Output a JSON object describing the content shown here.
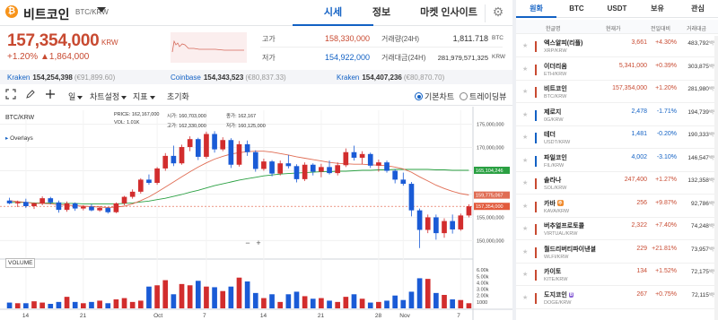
{
  "header": {
    "coin_glyph": "₿",
    "coin_name": "비트코인",
    "pair": "BTC/KRW",
    "tabs": [
      "시세",
      "정보",
      "마켓 인사이트"
    ],
    "active_tab": "시세"
  },
  "ticker": {
    "price": "157,354,000",
    "unit": "KRW",
    "change_pct": "+1.20%",
    "change_abs": "▲1,864,000",
    "stats": [
      {
        "label": "고가",
        "value": "158,330,000",
        "tone": "red"
      },
      {
        "label": "거래량(24H)",
        "value": "1,811.718",
        "unit": "BTC",
        "tone": "dark"
      },
      {
        "label": "저가",
        "value": "154,922,000",
        "tone": "blue"
      },
      {
        "label": "거래대금(24H)",
        "value": "281,979,571,325",
        "unit": "KRW",
        "tone": "dark"
      }
    ]
  },
  "exchanges": [
    {
      "name": "Kraken",
      "price": "154,254,398",
      "krw": "(€91,899.60)"
    },
    {
      "name": "Coinbase",
      "price": "154,343,523",
      "krw": "(€80,837.33)"
    },
    {
      "name": "Kraken",
      "price": "154,407,236",
      "krw": "(€80,870.70)"
    }
  ],
  "toolbar": {
    "interval": "일",
    "settings": "차트설정",
    "indicators": "지표",
    "reset": "초기화",
    "basic_chart": "기본차트",
    "tradingview": "트레이딩뷰"
  },
  "chart": {
    "symbol_label": "BTC/KRW",
    "overlays_label": "Overlays",
    "ohlc_left": [
      "PRICE:",
      "VOL:"
    ],
    "ohlc_left_vals": [
      "162,167,000",
      "1.01K"
    ],
    "ohlc_mid_labels": [
      "시가:",
      "고가:"
    ],
    "ohlc_mid_vals": [
      "160,703,000",
      "162,330,000"
    ],
    "ohlc_right_labels": [
      "종가:",
      "저가:"
    ],
    "ohlc_right_vals": [
      "162,167",
      "160,125,000"
    ],
    "volume_label": "VOLUME",
    "y_ticks": [
      "175,000,000",
      "170,000,000",
      "165,000,000",
      "160,000,000",
      "155,000,000",
      "150,000,000"
    ],
    "y_tags": [
      {
        "value": "165,104,246",
        "color": "#2aa042"
      },
      {
        "value": "159,775,067",
        "color": "#e06d54"
      },
      {
        "value": "157,354,000",
        "color": "#e25a3c"
      }
    ],
    "vol_ticks": [
      "6.00k",
      "5.00k",
      "4.00k",
      "3.00k",
      "2.00k",
      "1000"
    ],
    "x_ticks": [
      "14",
      "21",
      "Oct",
      "7",
      "14",
      "21",
      "28",
      "Nov",
      "7"
    ],
    "up_color": "#d22d2d",
    "down_color": "#1a5bd6"
  },
  "chart_data": {
    "type": "candlestick",
    "title": "BTC/KRW",
    "ylim": [
      147000000,
      178000000
    ],
    "series_ma": [
      {
        "name": "MA-long",
        "color": "#2aa042"
      },
      {
        "name": "MA-short",
        "color": "#e06d54"
      }
    ],
    "candles": [
      [
        158.6,
        159.2,
        157.8,
        158.0
      ],
      [
        158.0,
        158.6,
        157.2,
        158.3
      ],
      [
        158.3,
        159.0,
        157.0,
        157.4
      ],
      [
        157.4,
        158.2,
        156.8,
        158.0
      ],
      [
        158.0,
        159.5,
        157.6,
        159.1
      ],
      [
        159.1,
        159.4,
        157.8,
        158.2
      ],
      [
        158.2,
        158.6,
        156.0,
        156.6
      ],
      [
        156.6,
        158.4,
        156.2,
        158.0
      ],
      [
        158.0,
        158.2,
        156.4,
        156.9
      ],
      [
        156.9,
        157.6,
        156.5,
        157.3
      ],
      [
        157.3,
        157.8,
        156.3,
        156.5
      ],
      [
        156.5,
        157.4,
        156.2,
        157.0
      ],
      [
        157.0,
        157.2,
        155.8,
        156.1
      ],
      [
        156.1,
        158.2,
        155.9,
        158.0
      ],
      [
        158.0,
        159.6,
        157.6,
        159.4
      ],
      [
        159.4,
        161.0,
        159.0,
        160.5
      ],
      [
        160.5,
        163.4,
        160.1,
        163.1
      ],
      [
        163.1,
        164.2,
        162.0,
        162.4
      ],
      [
        162.4,
        165.8,
        162.0,
        165.5
      ],
      [
        165.5,
        168.8,
        165.0,
        168.2
      ],
      [
        168.2,
        170.4,
        166.0,
        166.6
      ],
      [
        166.6,
        170.6,
        166.3,
        170.1
      ],
      [
        170.1,
        172.4,
        169.2,
        171.8
      ],
      [
        171.8,
        172.1,
        167.3,
        168.0
      ],
      [
        168.0,
        173.4,
        167.6,
        172.9
      ],
      [
        172.9,
        173.5,
        168.9,
        169.6
      ],
      [
        169.6,
        172.2,
        169.2,
        171.6
      ],
      [
        171.6,
        172.0,
        165.6,
        166.3
      ],
      [
        166.3,
        171.4,
        165.9,
        170.7
      ],
      [
        170.7,
        171.5,
        168.2,
        169.0
      ],
      [
        169.0,
        169.4,
        164.8,
        165.4
      ],
      [
        165.4,
        167.6,
        165.0,
        167.0
      ],
      [
        167.0,
        167.3,
        163.8,
        164.4
      ],
      [
        164.4,
        167.2,
        164.0,
        166.6
      ],
      [
        166.6,
        168.4,
        165.5,
        166.0
      ],
      [
        166.0,
        166.4,
        162.5,
        163.2
      ],
      [
        163.2,
        166.8,
        162.8,
        166.3
      ],
      [
        166.3,
        166.6,
        164.0,
        164.8
      ],
      [
        164.8,
        166.5,
        163.6,
        165.8
      ],
      [
        165.8,
        167.2,
        164.2,
        164.5
      ],
      [
        164.5,
        166.8,
        164.0,
        166.2
      ],
      [
        166.2,
        169.8,
        165.8,
        169.0
      ],
      [
        169.0,
        170.4,
        167.2,
        167.8
      ],
      [
        167.8,
        169.2,
        166.4,
        168.6
      ],
      [
        168.6,
        168.9,
        165.6,
        166.1
      ],
      [
        166.1,
        167.4,
        164.8,
        166.8
      ],
      [
        166.8,
        167.2,
        164.6,
        165.0
      ],
      [
        165.0,
        165.4,
        162.3,
        163.1
      ],
      [
        163.1,
        164.6,
        161.8,
        162.2
      ],
      [
        162.2,
        162.6,
        155.2,
        156.5
      ],
      [
        156.5,
        156.9,
        148.4,
        152.3
      ],
      [
        152.3,
        155.6,
        151.6,
        155.0
      ],
      [
        155.0,
        155.6,
        150.2,
        151.6
      ],
      [
        151.6,
        154.8,
        150.6,
        154.2
      ],
      [
        154.2,
        155.6,
        151.5,
        152.4
      ],
      [
        152.4,
        155.8,
        152.1,
        155.4
      ],
      [
        155.4,
        157.8,
        155.0,
        157.35
      ]
    ],
    "ma_short": [
      158.6,
      158.4,
      158.2,
      158.0,
      158.0,
      157.9,
      157.7,
      157.6,
      157.5,
      157.4,
      157.3,
      157.2,
      157.1,
      157.2,
      157.4,
      157.9,
      158.6,
      159.4,
      160.4,
      161.5,
      162.6,
      163.7,
      164.8,
      165.8,
      166.7,
      167.5,
      168.1,
      168.6,
      168.9,
      169.1,
      169.2,
      169.2,
      169.0,
      168.7,
      168.4,
      168.0,
      167.7,
      167.4,
      167.1,
      166.8,
      166.6,
      166.5,
      166.4,
      166.4,
      166.3,
      166.2,
      166.1,
      165.8,
      165.4,
      164.7,
      163.7,
      162.8,
      161.9,
      161.2,
      160.6,
      160.1,
      159.8
    ],
    "ma_long": [
      158.2,
      158.2,
      158.2,
      158.1,
      158.1,
      158.1,
      158.0,
      158.0,
      158.0,
      157.9,
      157.9,
      157.9,
      157.9,
      157.9,
      158.0,
      158.1,
      158.3,
      158.5,
      158.8,
      159.1,
      159.5,
      159.9,
      160.4,
      160.8,
      161.3,
      161.8,
      162.2,
      162.6,
      163.0,
      163.3,
      163.6,
      163.9,
      164.1,
      164.3,
      164.4,
      164.5,
      164.6,
      164.7,
      164.8,
      164.8,
      164.9,
      164.9,
      165.0,
      165.1,
      165.1,
      165.2,
      165.2,
      165.3,
      165.3,
      165.3,
      165.3,
      165.3,
      165.2,
      165.2,
      165.1,
      165.1,
      165.1
    ],
    "volume": [
      0.9,
      0.8,
      0.8,
      1.1,
      0.9,
      0.7,
      1.0,
      1.8,
      1.0,
      0.8,
      1.0,
      1.2,
      0.8,
      1.4,
      1.6,
      1.0,
      1.2,
      3.4,
      3.6,
      4.4,
      2.2,
      3.8,
      3.6,
      4.3,
      3.4,
      3.3,
      2.7,
      3.4,
      4.8,
      4.2,
      2.4,
      1.6,
      2.2,
      1.0,
      2.2,
      2.6,
      1.9,
      1.5,
      1.6,
      1.2,
      1.0,
      1.8,
      2.2,
      1.5,
      0.9,
      1.0,
      1.2,
      2.0,
      1.3,
      2.6,
      4.7,
      4.6,
      2.4,
      2.1,
      1.4,
      1.3,
      0.8
    ]
  },
  "market": {
    "tabs": [
      "원화",
      "BTC",
      "USDT",
      "보유",
      "관심"
    ],
    "active_tab": "원화",
    "columns": [
      "한글명",
      "현재가",
      "전일대비",
      "거래대금"
    ],
    "volume_unit": "백만",
    "rows": [
      {
        "name": "엑스알피(리플)",
        "market": "XRP/KRW",
        "price": "3,661",
        "pct": "+4.30%",
        "vol": "483,792",
        "tone": "red"
      },
      {
        "name": "이더리움",
        "market": "ETH/KRW",
        "price": "5,341,000",
        "pct": "+0.39%",
        "vol": "303,875",
        "tone": "red"
      },
      {
        "name": "비트코인",
        "market": "BTC/KRW",
        "price": "157,354,000",
        "pct": "+1.20%",
        "vol": "281,980",
        "tone": "red"
      },
      {
        "name": "제로지",
        "market": "0G/KRW",
        "price": "2,478",
        "pct": "-1.71%",
        "vol": "194,739",
        "tone": "blue"
      },
      {
        "name": "테더",
        "market": "USDT/KRW",
        "price": "1,481",
        "pct": "-0.20%",
        "vol": "190,333",
        "tone": "blue"
      },
      {
        "name": "파일코인",
        "market": "FIL/KRW",
        "price": "4,002",
        "pct": "-3.10%",
        "vol": "146,547",
        "tone": "blue"
      },
      {
        "name": "솔라나",
        "market": "SOL/KRW",
        "price": "247,400",
        "pct": "+1.27%",
        "vol": "132,358",
        "tone": "red"
      },
      {
        "name": "카바",
        "market": "KAVA/KRW",
        "price": "256",
        "pct": "+9.87%",
        "vol": "92,786",
        "tone": "red",
        "badge": "주",
        "badge_color": "#f08a2c"
      },
      {
        "name": "버추얼프로토콜",
        "market": "VIRTUAL/KRW",
        "price": "2,322",
        "pct": "+7.40%",
        "vol": "74,248",
        "tone": "red"
      },
      {
        "name": "월드리버티파이낸셜",
        "market": "WLFI/KRW",
        "price": "229",
        "pct": "+21.81%",
        "vol": "73,957",
        "tone": "red"
      },
      {
        "name": "카이토",
        "market": "KITE/KRW",
        "price": "134",
        "pct": "+1.52%",
        "vol": "72,175",
        "tone": "red"
      },
      {
        "name": "도지코인",
        "market": "DOGE/KRW",
        "price": "267",
        "pct": "+0.75%",
        "vol": "72,115",
        "tone": "red",
        "badge": "B",
        "badge_color": "#8a62d6"
      }
    ]
  }
}
